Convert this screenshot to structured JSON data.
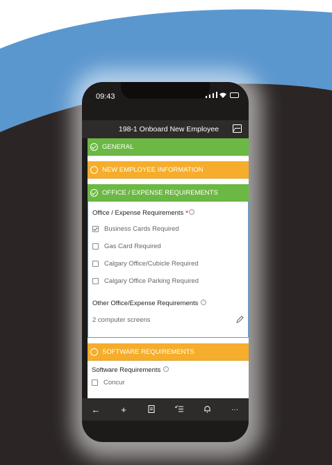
{
  "status_bar": {
    "time": "09:43"
  },
  "app_bar": {
    "title": "198-1 Onboard New Employee"
  },
  "sections": {
    "general": {
      "label": "GENERAL",
      "color": "#6cb844"
    },
    "new_employee": {
      "label": "NEW EMPLOYEE INFORMATION",
      "color": "#f5ad2b"
    },
    "office": {
      "label": "OFFICE / EXPENSE REQUIREMENTS",
      "color": "#6cb844"
    },
    "software": {
      "label": "SOFTWARE REQUIREMENTS",
      "color": "#f5ad2b"
    }
  },
  "office_panel": {
    "field_label": "Office / Expense Requirements",
    "required_mark": "*",
    "checkboxes": [
      {
        "label": "Business Cards Required",
        "checked": true
      },
      {
        "label": "Gas Card Required",
        "checked": false
      },
      {
        "label": "Calgary Office/Cubicle Required",
        "checked": false
      },
      {
        "label": "Calgary Office Parking Required",
        "checked": false
      }
    ],
    "other_label": "Other Office/Expense Requirements",
    "other_value": "2 computer screens"
  },
  "software_panel": {
    "field_label": "Software Requirements",
    "checkboxes": [
      {
        "label": "Concur",
        "checked": false
      }
    ]
  },
  "bottom_bar": {
    "icons": [
      "back-arrow-icon",
      "add-icon",
      "clipboard-icon",
      "checklist-icon",
      "bell-icon",
      "more-icon"
    ]
  },
  "colors": {
    "accent_blue": "#5a9bd5",
    "dark": "#2d2c2b"
  }
}
